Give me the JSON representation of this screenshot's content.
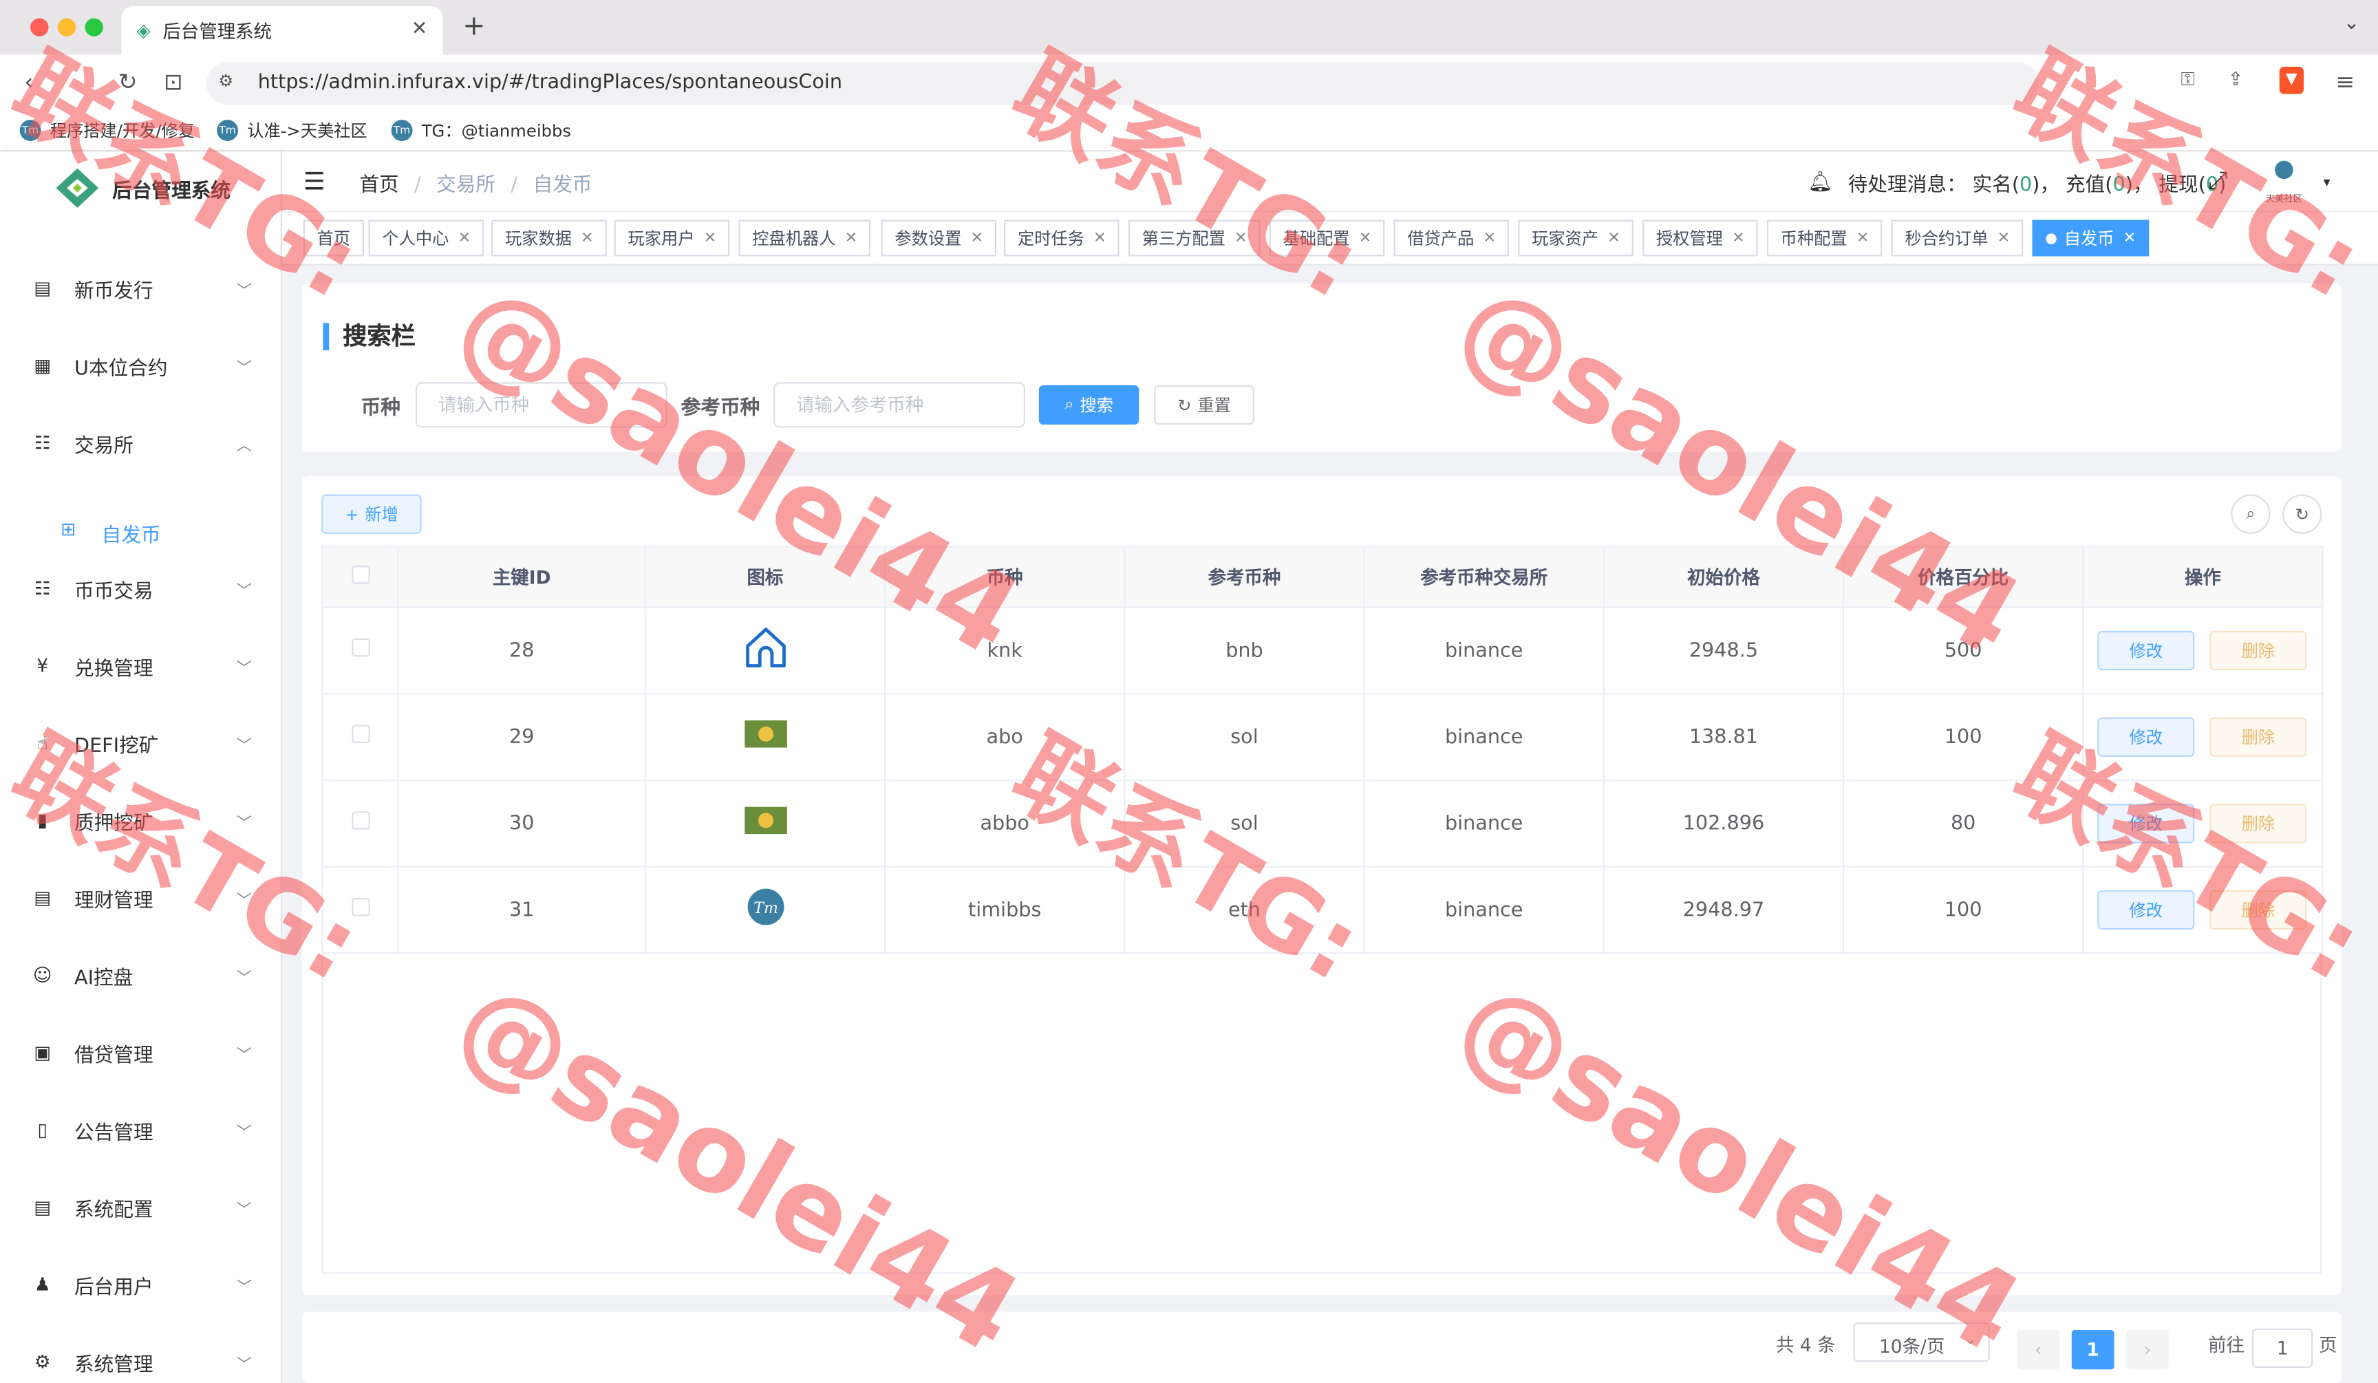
{
  "browser": {
    "tab_title": "后台管理系统",
    "url": "https://admin.infurax.vip/#/tradingPlaces/spontaneousCoin",
    "bookmarks": [
      "程序搭建/开发/修复",
      "认准->天美社区",
      "TG：@tianmeibbs"
    ]
  },
  "sidebar": {
    "app_title": "后台管理系统",
    "items": [
      {
        "label": "新币发行",
        "icon": "coin-icon"
      },
      {
        "label": "U本位合约",
        "icon": "grid-icon"
      },
      {
        "label": "交易所",
        "icon": "list-icon",
        "expanded": true
      },
      {
        "label": "币币交易",
        "icon": "list-icon"
      },
      {
        "label": "兑换管理",
        "icon": "yen-icon"
      },
      {
        "label": "DEFI挖矿",
        "icon": "hand-icon"
      },
      {
        "label": "质押挖矿",
        "icon": "bar-chart-icon"
      },
      {
        "label": "理财管理",
        "icon": "document-icon"
      },
      {
        "label": "AI控盘",
        "icon": "robot-icon"
      },
      {
        "label": "借贷管理",
        "icon": "wallet-icon"
      },
      {
        "label": "公告管理",
        "icon": "book-icon"
      },
      {
        "label": "系统配置",
        "icon": "document-icon"
      },
      {
        "label": "后台用户",
        "icon": "user-icon"
      },
      {
        "label": "系统管理",
        "icon": "gear-icon"
      }
    ],
    "sub_item": "自发币"
  },
  "header": {
    "breadcrumb": [
      "首页",
      "交易所",
      "自发币"
    ],
    "pending_label": "待处理消息：",
    "realname_label": "实名",
    "realname_count": "0",
    "recharge_label": "充值",
    "recharge_count": "0",
    "withdraw_label": "提现",
    "withdraw_count": "0",
    "avatar_text": "天美社区"
  },
  "tags": [
    "首页",
    "个人中心",
    "玩家数据",
    "玩家用户",
    "控盘机器人",
    "参数设置",
    "定时任务",
    "第三方配置",
    "基础配置",
    "借贷产品",
    "玩家资产",
    "授权管理",
    "币种配置",
    "秒合约订单",
    "自发币"
  ],
  "search": {
    "title": "搜索栏",
    "coin_label": "币种",
    "coin_placeholder": "请输入币种",
    "ref_label": "参考币种",
    "ref_placeholder": "请输入参考币种",
    "search_btn": "搜索",
    "reset_btn": "重置"
  },
  "table": {
    "add_btn": "新增",
    "columns": [
      "主键ID",
      "图标",
      "币种",
      "参考币种",
      "参考币种交易所",
      "初始价格",
      "价格百分比",
      "操作"
    ],
    "rows": [
      {
        "id": "28",
        "icon": "house-icon",
        "coin": "knk",
        "ref": "bnb",
        "exchange": "binance",
        "price": "2948.5",
        "percent": "500"
      },
      {
        "id": "29",
        "icon": "image-thumbnail-icon",
        "coin": "abo",
        "ref": "sol",
        "exchange": "binance",
        "price": "138.81",
        "percent": "100"
      },
      {
        "id": "30",
        "icon": "image-thumbnail-icon",
        "coin": "abbo",
        "ref": "sol",
        "exchange": "binance",
        "price": "102.896",
        "percent": "80"
      },
      {
        "id": "31",
        "icon": "tm-logo-icon",
        "coin": "timibbs",
        "ref": "eth",
        "exchange": "binance",
        "price": "2948.97",
        "percent": "100"
      }
    ],
    "edit_btn": "修改",
    "delete_btn": "删除"
  },
  "pagination": {
    "total": "共 4 条",
    "page_size": "10条/页",
    "current": "1",
    "goto_label": "前往",
    "goto_value": "1",
    "page_suffix": "页"
  },
  "watermark": {
    "line1": "联系TG:",
    "line2": "@saolei44"
  },
  "colors": {
    "primary": "#409eff",
    "watermark": "#f55050"
  }
}
